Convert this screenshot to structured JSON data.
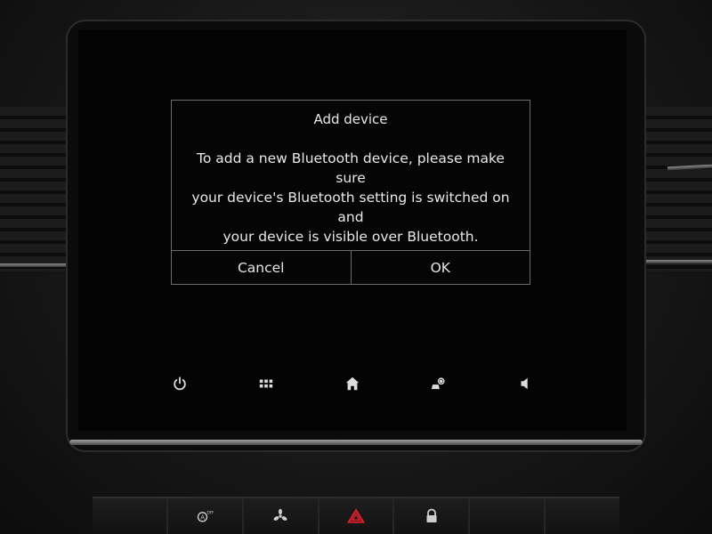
{
  "dialog": {
    "title": "Add device",
    "message_lines": [
      "To add a new Bluetooth device, please make sure",
      "your device's Bluetooth setting is switched on and",
      "your device is visible over Bluetooth."
    ],
    "cancel_label": "Cancel",
    "ok_label": "OK"
  },
  "navbar": {
    "items": [
      "power-icon",
      "apps-grid-icon",
      "home-icon",
      "car-settings-icon",
      "volume-icon"
    ]
  },
  "hardware_buttons": [
    "blank",
    "auto-stop-off-icon",
    "fan-icon",
    "hazard-icon",
    "lock-icon",
    "blank",
    "blank"
  ],
  "colors": {
    "hazard": "#e0202a",
    "text": "#e6e6e6",
    "border": "#6c6c6c"
  }
}
